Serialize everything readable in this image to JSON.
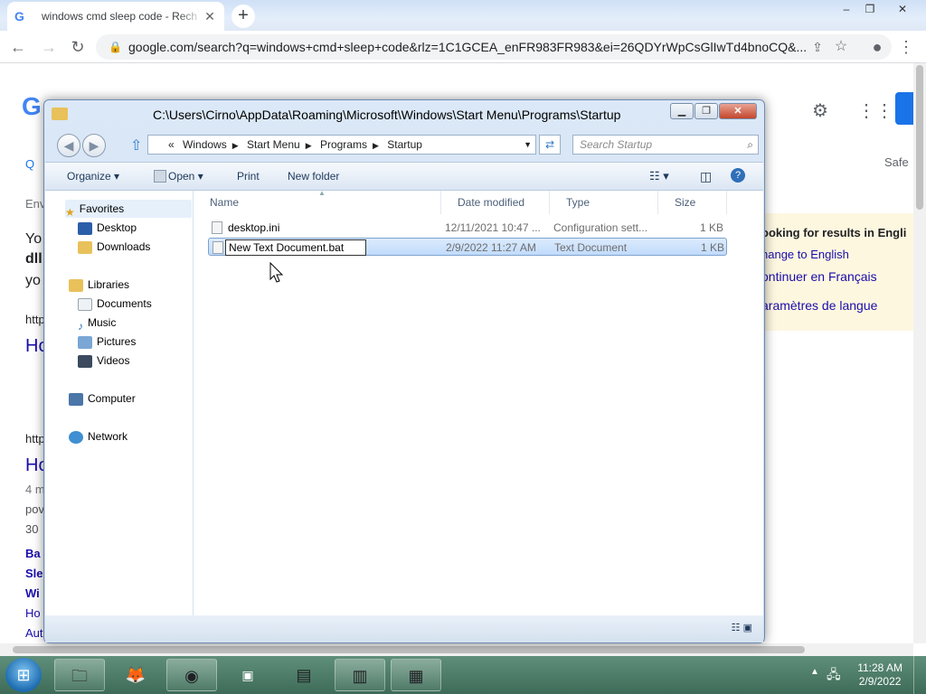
{
  "browser": {
    "tab_title": "windows cmd sleep code - Rech",
    "tab_close": "✕",
    "new_tab": "+",
    "url": "google.com/search?q=windows+cmd+sleep+code&rlz=1C1GCEA_enFR983FR983&ei=26QDYrWpCsGlIwTd4bnoCQ&...",
    "window_controls": [
      "–",
      "❐",
      "✕"
    ]
  },
  "google_page": {
    "logo": "G",
    "search_tab_hint": "Q",
    "env_text": "Env",
    "snippets": [
      "Yo",
      "dll",
      "yo",
      "http",
      "Ho",
      "http",
      "Ho",
      "4 m",
      "pov",
      "30",
      "Ba",
      "Sle",
      "Wi",
      "Ho",
      "Aut"
    ],
    "safe": "Safe",
    "lang_notice": {
      "title": "ooking for results in Engli",
      "link1": "hange to English",
      "link2": "ontinuer en Français",
      "link3": "aramètres de langue"
    }
  },
  "explorer": {
    "title": "C:\\Users\\Cirno\\AppData\\Roaming\\Microsoft\\Windows\\Start Menu\\Programs\\Startup",
    "controls": [
      "▁",
      "❐",
      "✕"
    ],
    "address": {
      "prefix": "«",
      "crumbs": [
        "Windows",
        "Start Menu",
        "Programs",
        "Startup"
      ]
    },
    "search_placeholder": "Search Startup",
    "commands": {
      "organize": "Organize ▾",
      "open": "Open ▾",
      "print": "Print",
      "new_folder": "New folder"
    },
    "nav": {
      "favorites": "Favorites",
      "desktop": "Desktop",
      "downloads": "Downloads",
      "libraries": "Libraries",
      "documents": "Documents",
      "music": "Music",
      "pictures": "Pictures",
      "videos": "Videos",
      "computer": "Computer",
      "network": "Network"
    },
    "columns": {
      "name": "Name",
      "date": "Date modified",
      "type": "Type",
      "size": "Size"
    },
    "files": [
      {
        "name": "desktop.ini",
        "date": "12/11/2021 10:47 ...",
        "type": "Configuration sett...",
        "size": "1 KB"
      },
      {
        "name": "New Text Document.bat",
        "date": "2/9/2022 11:27 AM",
        "type": "Text Document",
        "size": "1 KB"
      }
    ]
  },
  "taskbar": {
    "time": "11:28 AM",
    "date": "2/9/2022"
  }
}
